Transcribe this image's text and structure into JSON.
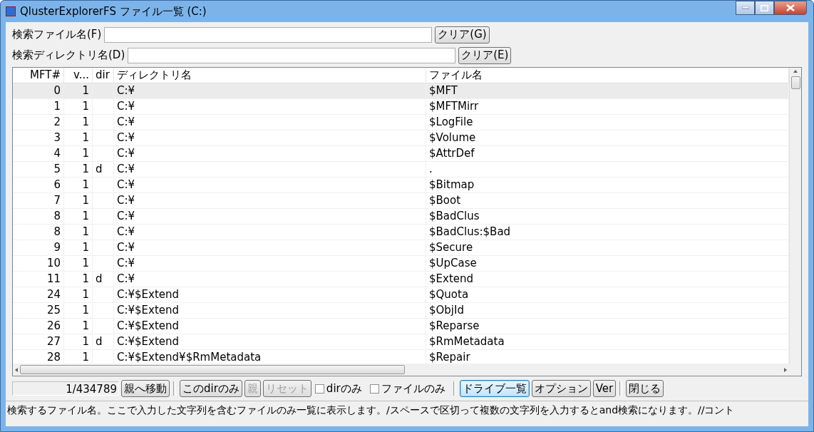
{
  "window": {
    "title": "QlusterExplorerFS ファイル一覧 (C:)"
  },
  "search_file": {
    "label": "検索ファイル名(F)",
    "clear_button": "クリア(G)"
  },
  "search_dir": {
    "label": "検索ディレクトリ名(D)",
    "clear_button": "クリア(E)"
  },
  "table": {
    "columns": [
      "MFT#",
      "v...",
      "dir",
      "ディレクトリ名",
      "ファイル名"
    ],
    "rows": [
      {
        "cells": [
          "0",
          "1",
          "",
          "C:¥",
          "$MFT"
        ],
        "selected": true
      },
      {
        "cells": [
          "1",
          "1",
          "",
          "C:¥",
          "$MFTMirr"
        ],
        "selected": false
      },
      {
        "cells": [
          "2",
          "1",
          "",
          "C:¥",
          "$LogFile"
        ],
        "selected": false
      },
      {
        "cells": [
          "3",
          "1",
          "",
          "C:¥",
          "$Volume"
        ],
        "selected": false
      },
      {
        "cells": [
          "4",
          "1",
          "",
          "C:¥",
          "$AttrDef"
        ],
        "selected": false
      },
      {
        "cells": [
          "5",
          "1",
          "d",
          "C:¥",
          "."
        ],
        "selected": false
      },
      {
        "cells": [
          "6",
          "1",
          "",
          "C:¥",
          "$Bitmap"
        ],
        "selected": false
      },
      {
        "cells": [
          "7",
          "1",
          "",
          "C:¥",
          "$Boot"
        ],
        "selected": false
      },
      {
        "cells": [
          "8",
          "1",
          "",
          "C:¥",
          "$BadClus"
        ],
        "selected": false
      },
      {
        "cells": [
          "8",
          "1",
          "",
          "C:¥",
          "$BadClus:$Bad"
        ],
        "selected": false
      },
      {
        "cells": [
          "9",
          "1",
          "",
          "C:¥",
          "$Secure"
        ],
        "selected": false
      },
      {
        "cells": [
          "10",
          "1",
          "",
          "C:¥",
          "$UpCase"
        ],
        "selected": false
      },
      {
        "cells": [
          "11",
          "1",
          "d",
          "C:¥",
          "$Extend"
        ],
        "selected": false
      },
      {
        "cells": [
          "24",
          "1",
          "",
          "C:¥$Extend",
          "$Quota"
        ],
        "selected": false
      },
      {
        "cells": [
          "25",
          "1",
          "",
          "C:¥$Extend",
          "$ObjId"
        ],
        "selected": false
      },
      {
        "cells": [
          "26",
          "1",
          "",
          "C:¥$Extend",
          "$Reparse"
        ],
        "selected": false
      },
      {
        "cells": [
          "27",
          "1",
          "d",
          "C:¥$Extend",
          "$RmMetadata"
        ],
        "selected": false
      },
      {
        "cells": [
          "28",
          "1",
          "",
          "C:¥$Extend¥$RmMetadata",
          "$Repair"
        ],
        "selected": false
      }
    ]
  },
  "toolbar": {
    "count": "1/434789",
    "items": [
      {
        "kind": "button",
        "label": "親へ移動",
        "disabled": false,
        "focused": false
      },
      {
        "kind": "separator"
      },
      {
        "kind": "button",
        "label": "このdirのみ",
        "disabled": false,
        "focused": false
      },
      {
        "kind": "button",
        "label": "親",
        "disabled": true,
        "focused": false
      },
      {
        "kind": "button",
        "label": "リセット",
        "disabled": true,
        "focused": false
      },
      {
        "kind": "checkbox",
        "label": "dirのみ",
        "checked": false
      },
      {
        "kind": "checkbox",
        "label": "ファイルのみ",
        "checked": false
      },
      {
        "kind": "separator"
      },
      {
        "kind": "button",
        "label": "ドライブ一覧",
        "disabled": false,
        "focused": true
      },
      {
        "kind": "button",
        "label": "オプション",
        "disabled": false,
        "focused": false
      },
      {
        "kind": "button",
        "label": "Ver",
        "disabled": false,
        "focused": false
      },
      {
        "kind": "separator"
      },
      {
        "kind": "button",
        "label": "閉じる",
        "disabled": false,
        "focused": false
      }
    ]
  },
  "status_bar": "検索するファイル名。ここで入力した文字列を含むファイルのみ一覧に表示します。/スペースで区切って複数の文字列を入力するとand検索になります。//コント"
}
